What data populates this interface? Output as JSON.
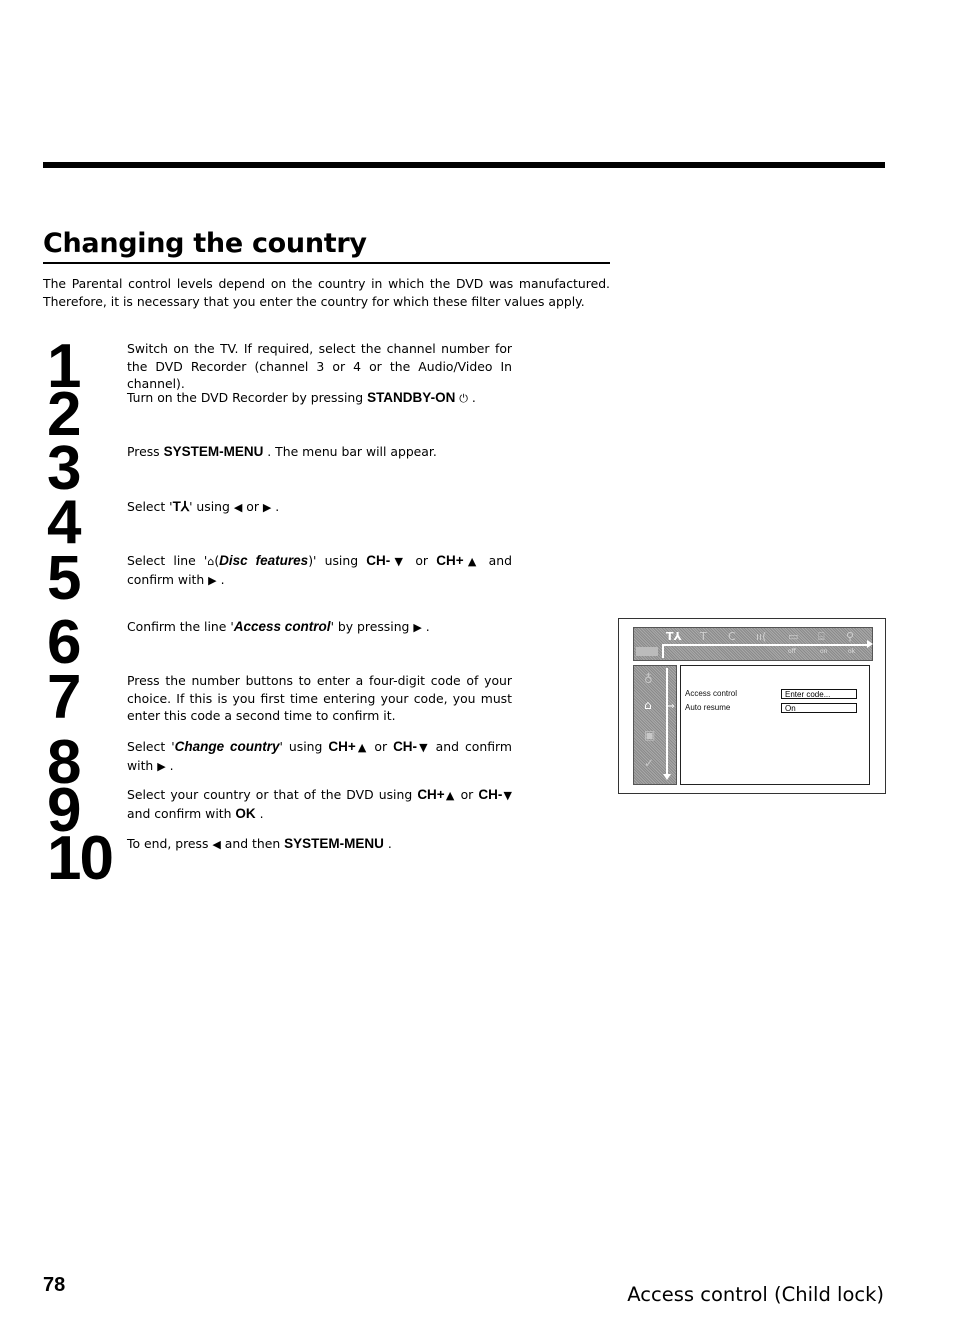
{
  "title": "Changing the country",
  "intro": "The Parental control levels depend on the country in which the DVD was manufactured. Therefore, it is necessary that you enter the country for which these filter values apply.",
  "steps": [
    {
      "num": "1",
      "text": "Switch on the TV. If required, select the channel number for the DVD Recorder (channel 3 or 4 or the Audio/Video In channel)."
    },
    {
      "num": "2",
      "pre": "Turn on the DVD Recorder by pressing ",
      "key": "STANDBY-ON",
      "glyph": "⏻",
      "post": " ."
    },
    {
      "num": "3",
      "pre": "Press ",
      "key": "SYSTEM-MENU",
      "post": " . The menu bar will appear."
    },
    {
      "num": "4",
      "pre": "Select '",
      "icon": "T⅄",
      "mid": "' using ",
      "left": "◀",
      "or": " or ",
      "right": "▶",
      "post": " ."
    },
    {
      "num": "5",
      "pre": "Select line '",
      "icon": "⌂",
      "open": "(",
      "italic": "Disc features",
      "close": ")' using ",
      "key1": "CH-",
      "down": "▼",
      "or": " or ",
      "key2": "CH+",
      "up": "▲",
      "and": " and confirm with ",
      "right": "▶",
      "post": " ."
    },
    {
      "num": "6",
      "pre": "Confirm the line '",
      "italic": "Access control",
      "mid": "' by pressing ",
      "right": "▶",
      "post": " ."
    },
    {
      "num": "7",
      "text": "Press the number buttons to enter a four-digit code of your choice. If this is you first time entering your code, you must enter this code a second time to confirm it."
    },
    {
      "num": "8",
      "pre": "Select '",
      "italic": "Change country",
      "mid": "' using ",
      "key1": "CH+",
      "up": "▲",
      "or": " or ",
      "key2": "CH-",
      "down": "▼",
      "and": " and confirm with ",
      "right": "▶",
      "post": " ."
    },
    {
      "num": "9",
      "pre": "Select your country or that of the DVD using ",
      "key1": "CH+",
      "up": "▲",
      "or": " or ",
      "key2": "CH-",
      "down": "▼",
      "and": " and confirm with ",
      "key3": "OK",
      "post": " ."
    },
    {
      "num": "10",
      "pre": "To end, press ",
      "left": "◀",
      "mid": " and then ",
      "key": "SYSTEM-MENU",
      "post": " ."
    }
  ],
  "screen": {
    "menubar_icons": [
      "T⅄",
      "T",
      "C",
      "ıı(",
      "▭",
      "⌸",
      "⚲"
    ],
    "menubar_sub": [
      "off",
      "on",
      "ok"
    ],
    "sidebar_icons": [
      "♁",
      "⌂",
      "▣",
      "✓"
    ],
    "pointer": "⇒",
    "rows": [
      {
        "label": "Access control",
        "value": "Enter code..."
      },
      {
        "label": "Auto resume",
        "value": "On"
      }
    ]
  },
  "footer": {
    "page_number": "78",
    "section": "Access control (Child lock)"
  }
}
